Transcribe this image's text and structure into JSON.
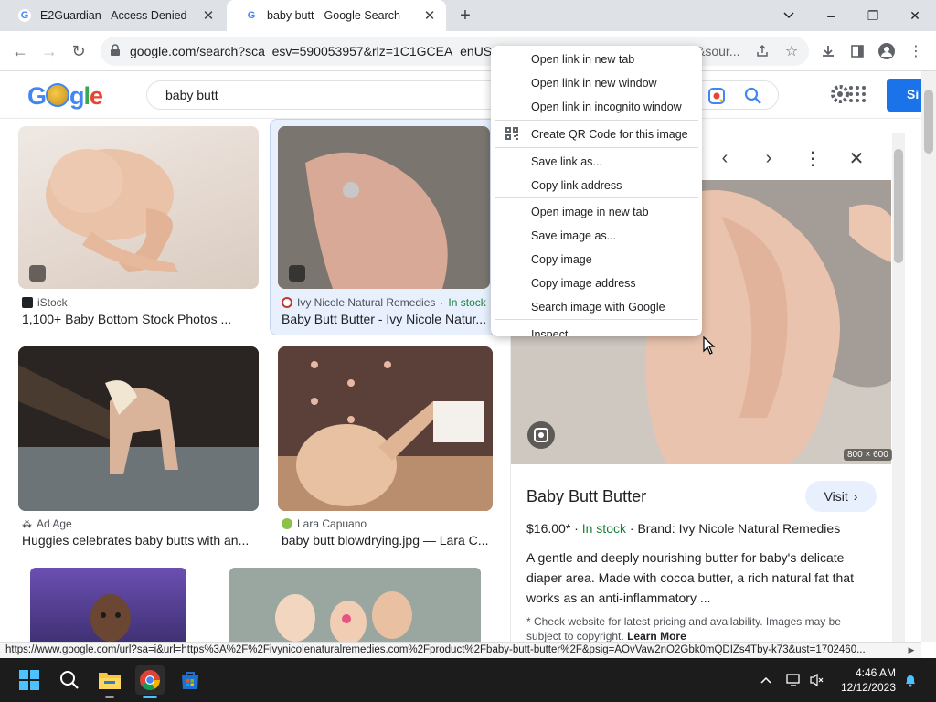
{
  "tabs": [
    {
      "title": "E2Guardian - Access Denied",
      "favicon": "google-g-icon"
    },
    {
      "title": "baby butt - Google Search",
      "favicon": "google-g-icon",
      "active": true
    }
  ],
  "window": {
    "minimize": "–",
    "restore": "❐",
    "close": "✕"
  },
  "toolbar": {
    "url": "google.com/search?sca_esv=590053957&rlz=1C1GCEA_enUS10",
    "url_tail": "&sour..."
  },
  "google": {
    "query": "baby butt",
    "signin_label": "Si"
  },
  "results": [
    {
      "source": "iStock",
      "title": "1,100+ Baby Bottom Stock Photos ..."
    },
    {
      "source": "Ivy Nicole Natural Remedies",
      "stock": "In stock",
      "title": "Baby Butt Butter - Ivy Nicole Natur..."
    },
    {
      "source": "Ad Age",
      "title": "Huggies celebrates baby butts with an..."
    },
    {
      "source": "Lara Capuano",
      "title": "baby butt blowdrying.jpg — Lara C..."
    }
  ],
  "panel": {
    "title": "Baby Butt Butter",
    "visit_label": "Visit",
    "dims": "800 × 600",
    "price": "$16.00*",
    "stock": "In stock",
    "brand": "Brand: Ivy Nicole Natural Remedies",
    "description": "A gentle and deeply nourishing butter for baby's delicate diaper area. Made with cocoa butter, a rich natural fat that works as an anti-inflammatory ...",
    "note": "* Check website for latest pricing and availability. Images may be subject to copyright.",
    "learn_more": "Learn More"
  },
  "context_menu": {
    "items": [
      "Open link in new tab",
      "Open link in new window",
      "Open link in incognito window",
      "Create QR Code for this image",
      "Save link as...",
      "Copy link address",
      "Open image in new tab",
      "Save image as...",
      "Copy image",
      "Copy image address",
      "Search image with Google",
      "Inspect"
    ]
  },
  "status_url": "https://www.google.com/url?sa=i&url=https%3A%2F%2Fivynicolenaturalremedies.com%2Fproduct%2Fbaby-butt-butter%2F&psig=AOvVaw2nO2Gbk0mQDIZs4Tby-k73&ust=1702460...",
  "taskbar": {
    "time": "4:46 AM",
    "date": "12/12/2023"
  },
  "colors": {
    "accent": "#1a73e8",
    "stock_green": "#188038",
    "taskbar": "#1c1c1c"
  }
}
